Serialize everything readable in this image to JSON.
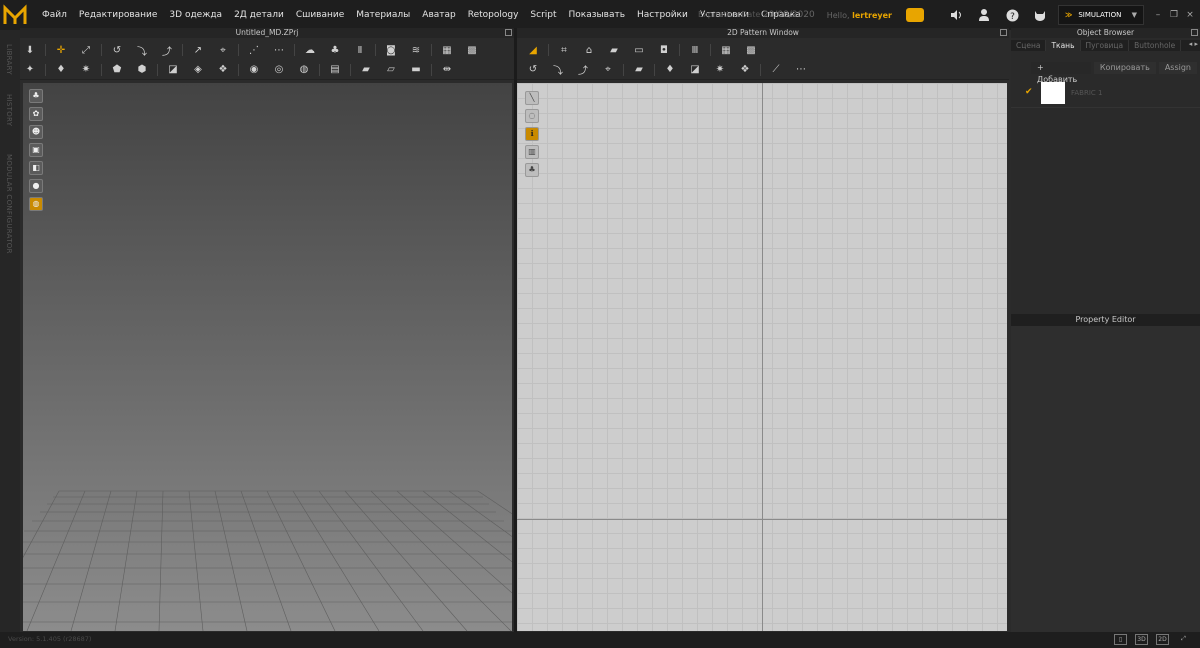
{
  "menu": [
    "Файл",
    "Редактирование",
    "3D одежда",
    "2Д детали",
    "Сшивание",
    "Материалы",
    "Аватар",
    "Retopology",
    "Script",
    "Показывать",
    "Настройки",
    "Установки",
    "Справка"
  ],
  "header": {
    "expiration_label": "Expiration Date",
    "expiration_date": "20/08/2020",
    "hello_label": "Hello,",
    "username": "lertreyer",
    "simulation_label": "SIMULATION"
  },
  "left_tabs": [
    "LIBRARY",
    "HISTORY",
    "MODULAR CONFIGURATOR"
  ],
  "panels": {
    "left_title": "Untitled_MD.ZPrj",
    "middle_title": "2D Pattern Window",
    "right_title": "Object Browser",
    "property_title": "Property Editor"
  },
  "object_browser": {
    "tabs": [
      "Сцена",
      "Ткань",
      "Пуговица",
      "Buttonhole"
    ],
    "active_tab": "Ткань",
    "add_label": "+ Добавить",
    "copy_label": "Копировать",
    "assign_label": "Assign",
    "fabric_name": "FABRIC 1",
    "fabric_color": "#ffffff"
  },
  "status": {
    "version": "Version: 5.1.405 (r28687)",
    "view_buttons": [
      "",
      "3D",
      "2D",
      ""
    ]
  },
  "colors": {
    "accent": "#e8a500",
    "menu_bg": "#1e1e1e",
    "canvas_2d": "#cdcdcd"
  },
  "icons": {
    "logo": "md-logo-icon",
    "cloud": "cloud-sync-icon",
    "speaker": "speaker-icon",
    "user": "user-icon",
    "help": "help-icon",
    "cat": "cat-icon"
  }
}
